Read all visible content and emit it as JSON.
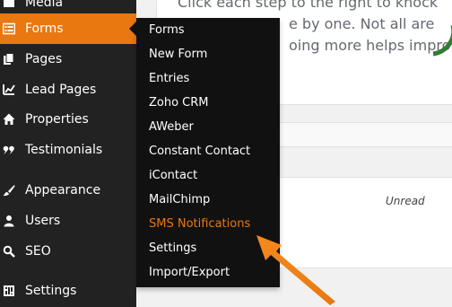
{
  "sidebar": {
    "items": [
      {
        "label": "Media",
        "icon": "media-icon"
      },
      {
        "label": "Forms",
        "icon": "forms-icon",
        "active": true
      },
      {
        "label": "Pages",
        "icon": "pages-icon"
      },
      {
        "label": "Lead Pages",
        "icon": "lead-pages-icon"
      },
      {
        "label": "Properties",
        "icon": "house-icon"
      },
      {
        "label": "Testimonials",
        "icon": "quote-icon"
      },
      {
        "label": "Appearance",
        "icon": "paintbrush-icon"
      },
      {
        "label": "Users",
        "icon": "user-icon"
      },
      {
        "label": "SEO",
        "icon": "search-icon"
      },
      {
        "label": "Settings",
        "icon": "settings-icon"
      }
    ]
  },
  "forms_submenu": {
    "items": [
      {
        "label": "Forms"
      },
      {
        "label": "New Form"
      },
      {
        "label": "Entries"
      },
      {
        "label": "Zoho CRM"
      },
      {
        "label": "AWeber"
      },
      {
        "label": "Constant Contact"
      },
      {
        "label": "iContact"
      },
      {
        "label": "MailChimp"
      },
      {
        "label": "SMS Notifications",
        "highlighted": true
      },
      {
        "label": "Settings"
      },
      {
        "label": "Import/Export"
      }
    ]
  },
  "main": {
    "intro_lines": [
      "Click each step to the right to knock",
      "e by one. Not all are",
      "oing more helps improve y"
    ],
    "table": {
      "status_cell": "Unread"
    }
  },
  "colors": {
    "sidebar_bg": "#222222",
    "flyout_bg": "#111111",
    "accent": "#e8780f",
    "content_bg": "#f1f1f1"
  }
}
